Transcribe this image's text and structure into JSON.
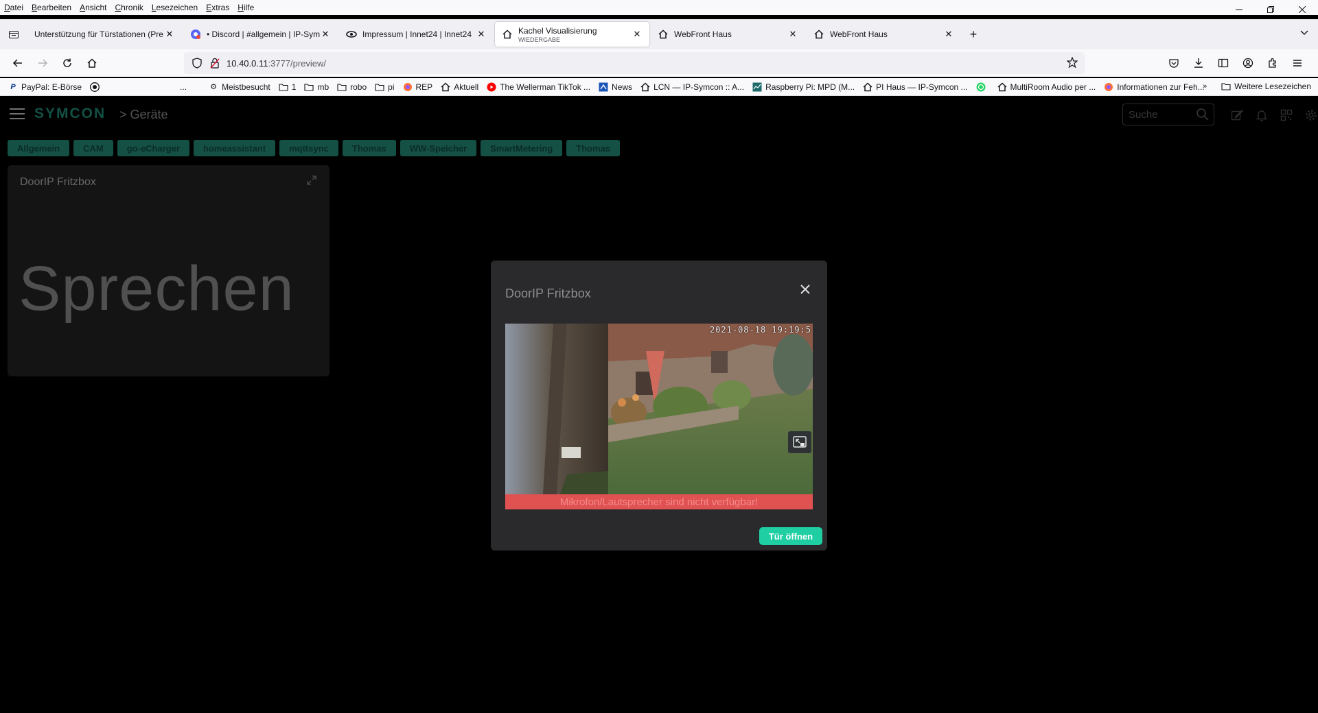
{
  "menubar": {
    "items": [
      "Datei",
      "Bearbeiten",
      "Ansicht",
      "Chronik",
      "Lesezeichen",
      "Extras",
      "Hilfe"
    ]
  },
  "tabs": [
    {
      "title": "Unterstützung für Türstationen (Pre",
      "sub": "",
      "icon": "generic-page-icon",
      "active": false
    },
    {
      "title": "• Discord | #allgemein | IP-Symc",
      "sub": "",
      "icon": "discord-icon",
      "active": false
    },
    {
      "title": "Impressum | Innet24 | Innet24",
      "sub": "",
      "icon": "innet24-icon",
      "active": false
    },
    {
      "title": "Kachel Visualisierung",
      "sub": "WIEDERGABE",
      "icon": "home-icon",
      "active": true
    },
    {
      "title": "WebFront Haus",
      "sub": "",
      "icon": "home-icon",
      "active": false
    },
    {
      "title": "WebFront Haus",
      "sub": "",
      "icon": "home-icon",
      "active": false
    }
  ],
  "navbar": {
    "url_host": "10.40.0.11",
    "url_path": ":3777/preview/"
  },
  "bookmarks": {
    "items": [
      {
        "label": "PayPal: E-Börse",
        "icon": "paypal-icon"
      },
      {
        "label": "",
        "icon": "github-icon"
      },
      {
        "label": "...",
        "icon": ""
      },
      {
        "label": "Meistbesucht",
        "icon": "gear-icon"
      },
      {
        "label": "1",
        "icon": "folder-icon"
      },
      {
        "label": "mb",
        "icon": "folder-icon"
      },
      {
        "label": "robo",
        "icon": "folder-icon"
      },
      {
        "label": "pi",
        "icon": "folder-icon"
      },
      {
        "label": "REP",
        "icon": "firefox-icon"
      },
      {
        "label": "Aktuell",
        "icon": "home-icon"
      },
      {
        "label": "The Wellerman TikTok ...",
        "icon": "youtube-icon"
      },
      {
        "label": "News",
        "icon": "news-icon"
      },
      {
        "label": "LCN — IP-Symcon :: A...",
        "icon": "home-icon"
      },
      {
        "label": "Raspberry Pi: MPD (M...",
        "icon": "chart-icon"
      },
      {
        "label": "PI Haus — IP-Symcon ...",
        "icon": "home-icon"
      },
      {
        "label": "",
        "icon": "whatsapp-icon"
      },
      {
        "label": "MultiRoom Audio per ...",
        "icon": "home-icon"
      },
      {
        "label": "Informationen zur Feh...",
        "icon": "firefox-icon"
      }
    ],
    "more_label": "Weitere Lesezeichen"
  },
  "app": {
    "logo": "SYMCON",
    "breadcrumb": "> Geräte",
    "search_placeholder": "Suche",
    "categories": [
      "Allgemein",
      "CAM",
      "go-eCharger",
      "homeassistant",
      "mqttsync",
      "Thomas",
      "WW-Speicher",
      "SmartMetering",
      "Thomas"
    ],
    "tile": {
      "title": "DoorIP Fritzbox",
      "big_text": "Sprechen"
    }
  },
  "dialog": {
    "title": "DoorIP Fritzbox",
    "timestamp": "2021-08-18 19:19:5",
    "error": "Mikrofon/Lautsprecher sind nicht verfügbar!",
    "door_button": "Tür öffnen"
  },
  "colors": {
    "accent": "#1fcfa3",
    "category_bg": "#1c6b5c",
    "error_bg": "#e05252",
    "tile_bg": "#1b1b1d",
    "dialog_bg": "#2a2a2c"
  }
}
